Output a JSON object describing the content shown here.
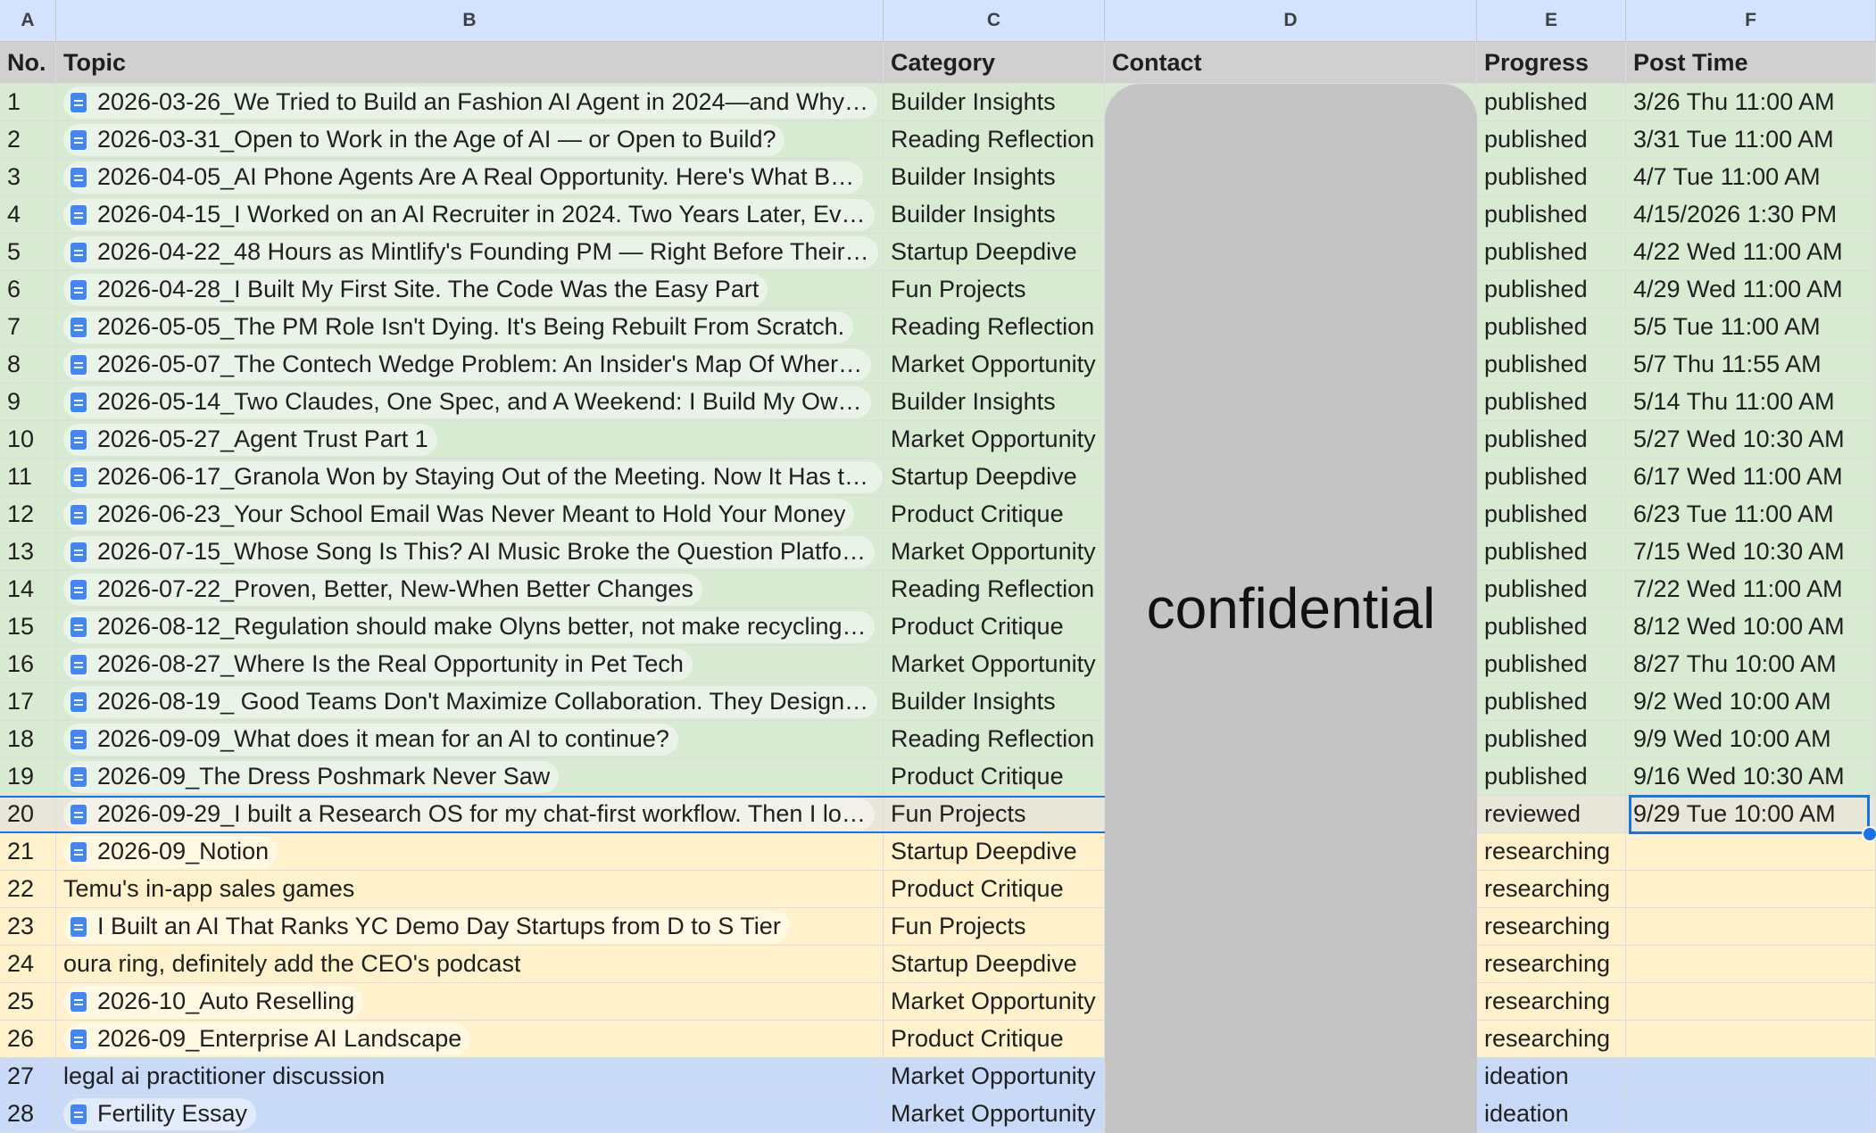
{
  "columns": [
    "A",
    "B",
    "C",
    "D",
    "E",
    "F"
  ],
  "header": {
    "no": "No.",
    "topic": "Topic",
    "category": "Category",
    "contact": "Contact",
    "progress": "Progress",
    "post_time": "Post Time"
  },
  "confidential_label": "confidential",
  "status_colors": {
    "published": "#d9ead3",
    "reviewed": "#e8e6d9",
    "researching": "#fff2cc",
    "ideation": "#c9daf8"
  },
  "rows": [
    {
      "no": "1",
      "topic": "2026-03-26_We Tried to Build an Fashion AI Agent in 2024—and Why…",
      "chip": true,
      "category": "Builder Insights",
      "progress": "published",
      "post_time": "3/26 Thu 11:00 AM"
    },
    {
      "no": "2",
      "topic": "2026-03-31_Open to Work in the Age of AI — or Open to Build?",
      "chip": true,
      "category": "Reading Reflection",
      "progress": "published",
      "post_time": "3/31 Tue 11:00 AM"
    },
    {
      "no": "3",
      "topic": "2026-04-05_AI Phone Agents Are A Real Opportunity. Here's What B…",
      "chip": true,
      "category": "Builder Insights",
      "progress": "published",
      "post_time": "4/7 Tue 11:00 AM"
    },
    {
      "no": "4",
      "topic": "2026-04-15_I Worked on an AI Recruiter in 2024. Two Years Later, Ev…",
      "chip": true,
      "category": "Builder Insights",
      "progress": "published",
      "post_time": "4/15/2026 1:30 PM"
    },
    {
      "no": "5",
      "topic": "2026-04-22_48 Hours as Mintlify's Founding PM — Right Before Their…",
      "chip": true,
      "category": "Startup Deepdive",
      "progress": "published",
      "post_time": "4/22 Wed 11:00 AM"
    },
    {
      "no": "6",
      "topic": "2026-04-28_I Built My First Site. The Code Was the Easy Part",
      "chip": true,
      "category": "Fun Projects",
      "progress": "published",
      "post_time": "4/29 Wed 11:00 AM"
    },
    {
      "no": "7",
      "topic": "2026-05-05_The PM Role Isn't Dying. It's Being Rebuilt From Scratch.",
      "chip": true,
      "category": "Reading Reflection",
      "progress": "published",
      "post_time": "5/5 Tue 11:00 AM"
    },
    {
      "no": "8",
      "topic": "2026-05-07_The Contech Wedge Problem: An Insider's Map Of Wher…",
      "chip": true,
      "category": "Market Opportunity",
      "progress": "published",
      "post_time": "5/7 Thu 11:55 AM"
    },
    {
      "no": "9",
      "topic": "2026-05-14_Two Claudes, One Spec, and A Weekend: I Build My Ow…",
      "chip": true,
      "category": "Builder Insights",
      "progress": "published",
      "post_time": "5/14 Thu 11:00 AM"
    },
    {
      "no": "10",
      "topic": "2026-05-27_Agent Trust Part 1",
      "chip": true,
      "category": "Market Opportunity",
      "progress": "published",
      "post_time": "5/27 Wed 10:30 AM"
    },
    {
      "no": "11",
      "topic": "2026-06-17_Granola Won by Staying Out of the Meeting. Now It Has to …",
      "chip": true,
      "category": "Startup Deepdive",
      "progress": "published",
      "post_time": "6/17 Wed 11:00 AM"
    },
    {
      "no": "12",
      "topic": "2026-06-23_Your School Email Was Never Meant to Hold Your Money",
      "chip": true,
      "category": "Product Critique",
      "progress": "published",
      "post_time": "6/23 Tue 11:00 AM"
    },
    {
      "no": "13",
      "topic": "2026-07-15_Whose Song Is This? AI Music Broke the Question Platfo…",
      "chip": true,
      "category": "Market Opportunity",
      "progress": "published",
      "post_time": "7/15 Wed 10:30 AM"
    },
    {
      "no": "14",
      "topic": "2026-07-22_Proven, Better, New-When Better Changes",
      "chip": true,
      "category": "Reading Reflection",
      "progress": "published",
      "post_time": "7/22 Wed 11:00 AM"
    },
    {
      "no": "15",
      "topic": "2026-08-12_Regulation should make Olyns better, not make recycling…",
      "chip": true,
      "category": "Product Critique",
      "progress": "published",
      "post_time": "8/12 Wed 10:00 AM"
    },
    {
      "no": "16",
      "topic": "2026-08-27_Where Is the Real Opportunity in Pet Tech",
      "chip": true,
      "category": "Market Opportunity",
      "progress": "published",
      "post_time": "8/27 Thu 10:00 AM"
    },
    {
      "no": "17",
      "topic": "2026-08-19_ Good Teams Don't Maximize Collaboration. They Design…",
      "chip": true,
      "category": "Builder Insights",
      "progress": "published",
      "post_time": "9/2 Wed 10:00 AM"
    },
    {
      "no": "18",
      "topic": "2026-09-09_What does it mean for an AI to continue?",
      "chip": true,
      "category": "Reading Reflection",
      "progress": "published",
      "post_time": "9/9 Wed 10:00 AM"
    },
    {
      "no": "19",
      "topic": "2026-09_The Dress Poshmark Never Saw",
      "chip": true,
      "category": "Product Critique",
      "progress": "published",
      "post_time": "9/16 Wed 10:30 AM"
    },
    {
      "no": "20",
      "topic": "2026-09-29_I built a Research OS for my chat-first workflow. Then I lo…",
      "chip": true,
      "category": "Fun Projects",
      "progress": "reviewed",
      "post_time": "9/29 Tue 10:00 AM"
    },
    {
      "no": "21",
      "topic": "2026-09_Notion",
      "chip": true,
      "category": "Startup Deepdive",
      "progress": "researching",
      "post_time": ""
    },
    {
      "no": "22",
      "topic": "Temu's in-app sales games",
      "chip": false,
      "category": "Product Critique",
      "progress": "researching",
      "post_time": ""
    },
    {
      "no": "23",
      "topic": "I Built an AI That Ranks YC Demo Day Startups from D to S Tier",
      "chip": true,
      "category": "Fun Projects",
      "progress": "researching",
      "post_time": ""
    },
    {
      "no": "24",
      "topic": "oura ring, definitely add the CEO's podcast",
      "chip": false,
      "category": "Startup Deepdive",
      "progress": "researching",
      "post_time": ""
    },
    {
      "no": "25",
      "topic": "2026-10_Auto Reselling",
      "chip": true,
      "category": "Market Opportunity",
      "progress": "researching",
      "post_time": ""
    },
    {
      "no": "26",
      "topic": "2026-09_Enterprise AI Landscape",
      "chip": true,
      "category": "Product Critique",
      "progress": "researching",
      "post_time": ""
    },
    {
      "no": "27",
      "topic": "legal ai practitioner discussion",
      "chip": false,
      "category": "Market Opportunity",
      "progress": "ideation",
      "post_time": ""
    },
    {
      "no": "28",
      "topic": "Fertility Essay",
      "chip": true,
      "category": "Market Opportunity",
      "progress": "ideation",
      "post_time": ""
    }
  ]
}
